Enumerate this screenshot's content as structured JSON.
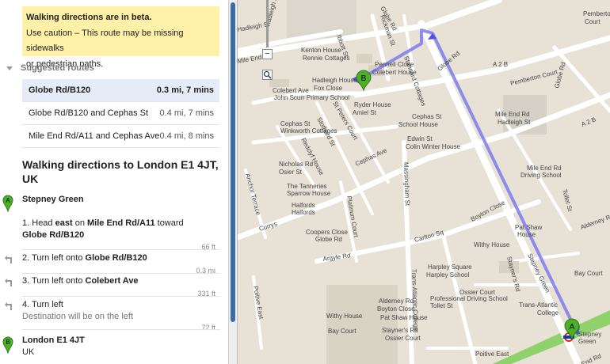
{
  "beta": {
    "title": "Walking directions are in beta.",
    "line1": "Use caution – This route may be missing sidewalks",
    "line2": "or pedestrian paths."
  },
  "routes": {
    "header": "Suggested routes",
    "items": [
      {
        "name": "Globe Rd/B120",
        "meta": "0.3 mi, 7 mins"
      },
      {
        "name": "Globe Rd/B120 and Cephas St",
        "meta": "0.4 mi, 7 mins"
      },
      {
        "name": "Mile End Rd/A11 and Cephas Ave",
        "meta": "0.4 mi, 8 mins"
      }
    ]
  },
  "directions": {
    "title": "Walking directions to London E1 4JT, UK",
    "start": {
      "marker": "A",
      "name": "Stepney Green"
    },
    "steps": [
      {
        "num": "1.",
        "pre": "Head ",
        "b1": "east",
        "mid": " on ",
        "b2": "Mile End Rd/A11",
        "post": " toward",
        "line2": "Globe Rd/B120",
        "dist": "66 ft"
      },
      {
        "num": "2.",
        "pre": "Turn left onto ",
        "b1": "Globe Rd/B120",
        "dist": "0.3 mi"
      },
      {
        "num": "3.",
        "pre": "Turn left onto ",
        "b1": "Colebert Ave",
        "dist": "331 ft"
      },
      {
        "num": "4.",
        "pre": "Turn left",
        "sub": "Destination will be on the left",
        "dist": "72 ft"
      }
    ],
    "end": {
      "marker": "B",
      "name": "London E1 4JT",
      "sub": "UK"
    }
  },
  "map": {
    "labels": [
      "Hadleigh St",
      "Globe Rd",
      "Rickman St",
      "Ibbott St",
      "Kenton House",
      "Rennie Cottages",
      "Pennell Close",
      "Colebert House",
      "Stannard Cottages",
      "Hadleigh House",
      "Fox Close",
      "Ryder House",
      "Amiel St",
      "Colebert Ave",
      "John Scurr Primary School",
      "St Peters Court",
      "Cephas St",
      "Winkworth Cottages",
      "Redclyf House",
      "Stothard St",
      "Cephas St",
      "School House",
      "Edwin St",
      "Colin Winter House",
      "Cephas Ave",
      "Nicholas Rd",
      "Osier St",
      "The Tanneries",
      "Sparrow House",
      "Anchor Terrace",
      "Currys",
      "Halfords",
      "Halfords",
      "Platinum Court",
      "Coopers Close",
      "Globe Rd",
      "Massingham St",
      "Argyle Rd",
      "Carlton Sq",
      "Harpley Square",
      "Harpley School",
      "Professional Driving School",
      "Tollet St",
      "Alderney Rd",
      "Boyton Close",
      "Pat Shaw House",
      "Withy House",
      "Bay Court",
      "Stayner's Rd",
      "Ossier Court",
      "Trans-Atlantic College",
      "Poitive East",
      "Stepney Green",
      "Pemberton Court",
      "Globe Rd",
      "A 2 B",
      "Mile End Rd",
      "Hadleigh St",
      "Mile End Rd"
    ],
    "marker_a": "A",
    "marker_b": "B",
    "zoom_minus": "−"
  },
  "colors": {
    "route": "#7b7bf0",
    "beta_bg": "#fff1a8",
    "selected_route_bg": "#e6ecf7",
    "marker": "#4caf27",
    "main_road": "#8fd16b"
  }
}
